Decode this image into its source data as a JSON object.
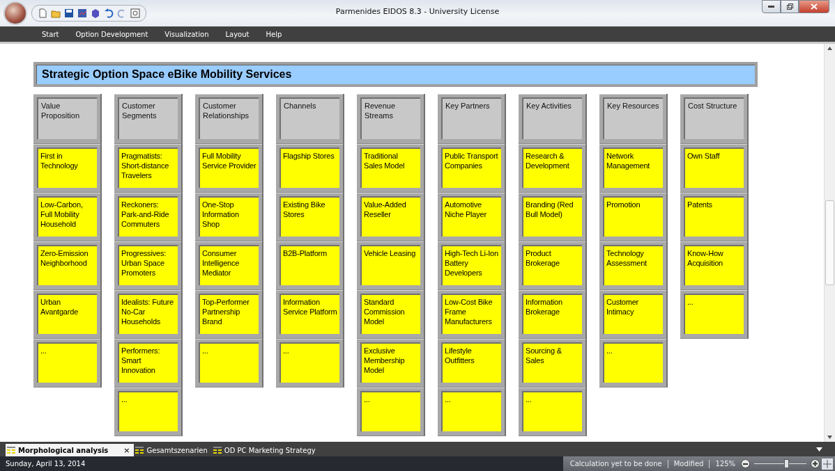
{
  "window": {
    "title": "Parmenides EIDOS 8.3 - University License"
  },
  "menu": [
    {
      "label": "Start"
    },
    {
      "label": "Option Development"
    },
    {
      "label": "Visualization"
    },
    {
      "label": "Layout"
    },
    {
      "label": "Help"
    }
  ],
  "canvas_title": "Strategic Option Space eBike Mobility Services",
  "columns": [
    {
      "header": "Value Proposition",
      "options": [
        "First in Technology",
        "Low-Carbon, Full Mobility Household",
        "Zero-Emission Neighborhood",
        "Urban Avantgarde",
        "..."
      ]
    },
    {
      "header": "Customer Segments",
      "options": [
        "Pragmatists: Short-distance Travelers",
        "Reckoners: Park-and-Ride Commuters",
        "Progressives: Urban Space Promoters",
        "Idealists: Future No-Car Households",
        "Performers: Smart Innovation",
        "..."
      ]
    },
    {
      "header": "Customer Relationships",
      "options": [
        "Full Mobility Service Provider",
        "One-Stop Information Shop",
        "Consumer Intelligence Mediator",
        "Top-Performer Partnership Brand",
        "..."
      ]
    },
    {
      "header": "Channels",
      "options": [
        "Flagship Stores",
        "Existing Bike Stores",
        "B2B-Platform",
        "Information Service Platform",
        "..."
      ]
    },
    {
      "header": "Revenue Streams",
      "options": [
        "Traditional Sales Model",
        "Value-Added Reseller",
        "Vehicle Leasing",
        "Standard Commission Model",
        "Exclusive Membership Model",
        "..."
      ]
    },
    {
      "header": "Key Partners",
      "options": [
        "Public Transport Companies",
        "Automotive Niche Player",
        "High-Tech Li-Ion Battery Developers",
        "Low-Cost Bike Frame Manufacturers",
        "Lifestyle Outfitters",
        "..."
      ]
    },
    {
      "header": "Key Activities",
      "options": [
        "Research & Development",
        "Branding (Red Bull Model)",
        "Product Brokerage",
        "Information Brokerage",
        "Sourcing & Sales",
        "..."
      ]
    },
    {
      "header": "Key Resources",
      "options": [
        "Network Management",
        "Promotion",
        "Technology Assessment",
        "Customer Intimacy",
        "..."
      ]
    },
    {
      "header": "Cost Structure",
      "options": [
        "Own Staff",
        "Patents",
        "Know-How Acquisition",
        "..."
      ]
    }
  ],
  "doc_tabs": [
    {
      "label": "Morphological analysis",
      "selected": true,
      "close": "×"
    },
    {
      "label": "Gesamtszenarien",
      "selected": false
    },
    {
      "label": "OD PC Marketing Strategy",
      "selected": false
    }
  ],
  "status_bar": {
    "date": "Sunday, April 13, 2014",
    "calculation": "Calculation yet to be done",
    "modified": "Modified",
    "zoom": "125%",
    "zoom_slider": {
      "level": 0.62
    }
  }
}
